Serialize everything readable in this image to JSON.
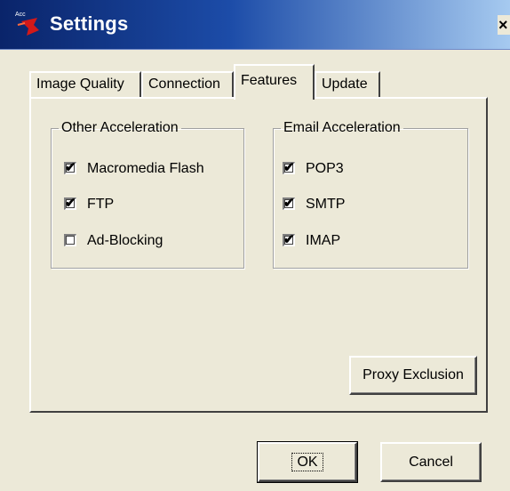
{
  "window": {
    "title": "Settings",
    "close_glyph": "×"
  },
  "tabs": [
    {
      "label": "Image Quality",
      "active": false
    },
    {
      "label": "Connection",
      "active": false
    },
    {
      "label": "Features",
      "active": true
    },
    {
      "label": "Update",
      "active": false
    }
  ],
  "other_acceleration": {
    "legend": "Other Acceleration",
    "items": [
      {
        "label": "Macromedia Flash",
        "checked": true
      },
      {
        "label": "FTP",
        "checked": true
      },
      {
        "label": "Ad-Blocking",
        "checked": false
      }
    ]
  },
  "email_acceleration": {
    "legend": "Email Acceleration",
    "items": [
      {
        "label": "POP3",
        "checked": true
      },
      {
        "label": "SMTP",
        "checked": true
      },
      {
        "label": "IMAP",
        "checked": true
      }
    ]
  },
  "buttons": {
    "proxy_exclusion": "Proxy Exclusion",
    "ok": "OK",
    "cancel": "Cancel"
  },
  "check_glyph": "✔"
}
